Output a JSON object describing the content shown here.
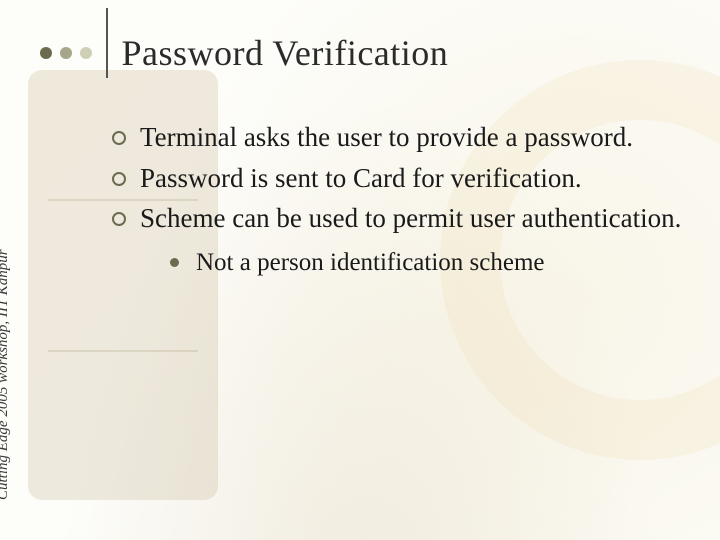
{
  "title": "Password Verification",
  "sidebar_label": "Cutting Edge 2005 workshop, IIT Kanpur",
  "bullets": {
    "b1": "Terminal asks the user to provide a password.",
    "b2": "Password is sent to Card for verification.",
    "b3": "Scheme can be used to permit user authentication."
  },
  "sub_bullets": {
    "s1": "Not a person identification scheme"
  }
}
